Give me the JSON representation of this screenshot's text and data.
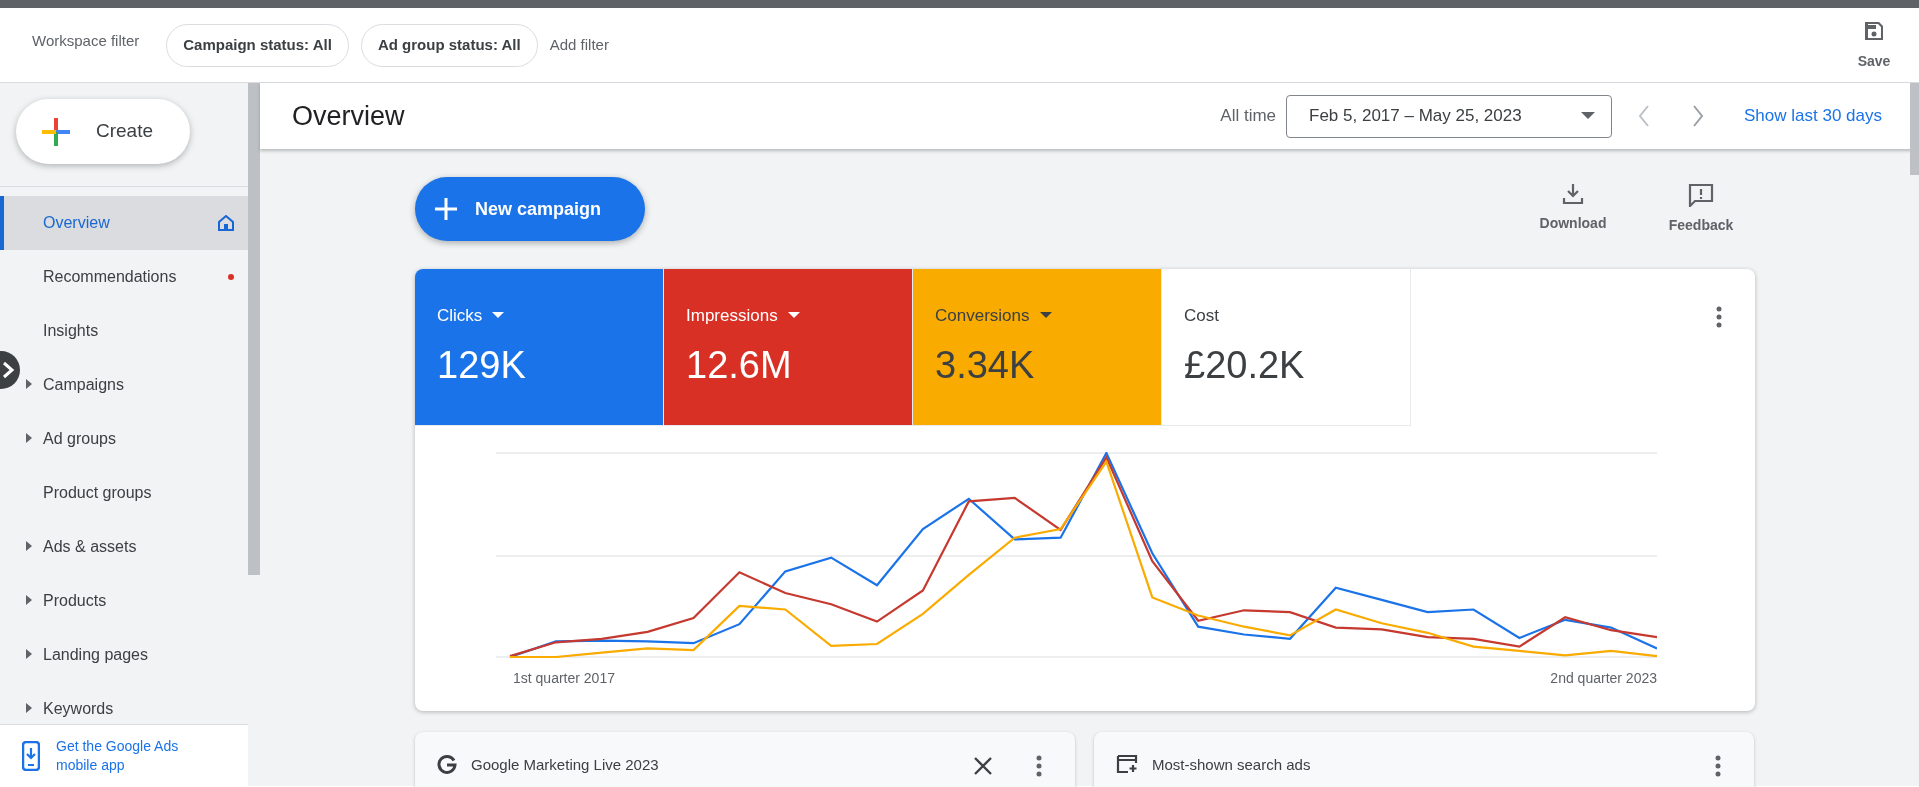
{
  "filter_bar": {
    "title": "Workspace filter",
    "chips": [
      "Campaign status: All",
      "Ad group status: All"
    ],
    "add_filter": "Add filter",
    "save": "Save"
  },
  "create_button": "Create",
  "sidebar": {
    "items": [
      {
        "label": "Overview",
        "kind": "home",
        "selected": true
      },
      {
        "label": "Recommendations",
        "kind": "alert",
        "selected": false
      },
      {
        "label": "Insights",
        "kind": "plain",
        "selected": false
      },
      {
        "label": "Campaigns",
        "kind": "expandable",
        "selected": false
      },
      {
        "label": "Ad groups",
        "kind": "expandable",
        "selected": false
      },
      {
        "label": "Product groups",
        "kind": "plain",
        "selected": false
      },
      {
        "label": "Ads & assets",
        "kind": "expandable",
        "selected": false
      },
      {
        "label": "Products",
        "kind": "expandable",
        "selected": false
      },
      {
        "label": "Landing pages",
        "kind": "expandable",
        "selected": false
      },
      {
        "label": "Keywords",
        "kind": "expandable",
        "selected": false
      }
    ],
    "footer_link": "Get the Google Ads mobile app"
  },
  "header": {
    "title": "Overview",
    "range_label": "All time",
    "date_range": "Feb 5, 2017 – May 25, 2023",
    "show_last": "Show last 30 days"
  },
  "actions": {
    "new_campaign": "New campaign",
    "download": "Download",
    "feedback": "Feedback"
  },
  "metrics": [
    {
      "label": "Clicks",
      "value": "129K",
      "color": "#1a73e8",
      "dropdown": true
    },
    {
      "label": "Impressions",
      "value": "12.6M",
      "color": "#d93025",
      "dropdown": true
    },
    {
      "label": "Conversions",
      "value": "3.34K",
      "color": "#f9ab00",
      "dropdown": true
    },
    {
      "label": "Cost",
      "value": "£20.2K",
      "color": "#ffffff",
      "dropdown": false
    }
  ],
  "chart": {
    "x_start_label": "1st quarter 2017",
    "x_end_label": "2nd quarter 2023"
  },
  "cards": [
    {
      "kind": "news",
      "title": "Google Marketing Live 2023",
      "dismissible": true
    },
    {
      "kind": "ads",
      "title": "Most-shown search ads",
      "dismissible": false
    }
  ]
}
